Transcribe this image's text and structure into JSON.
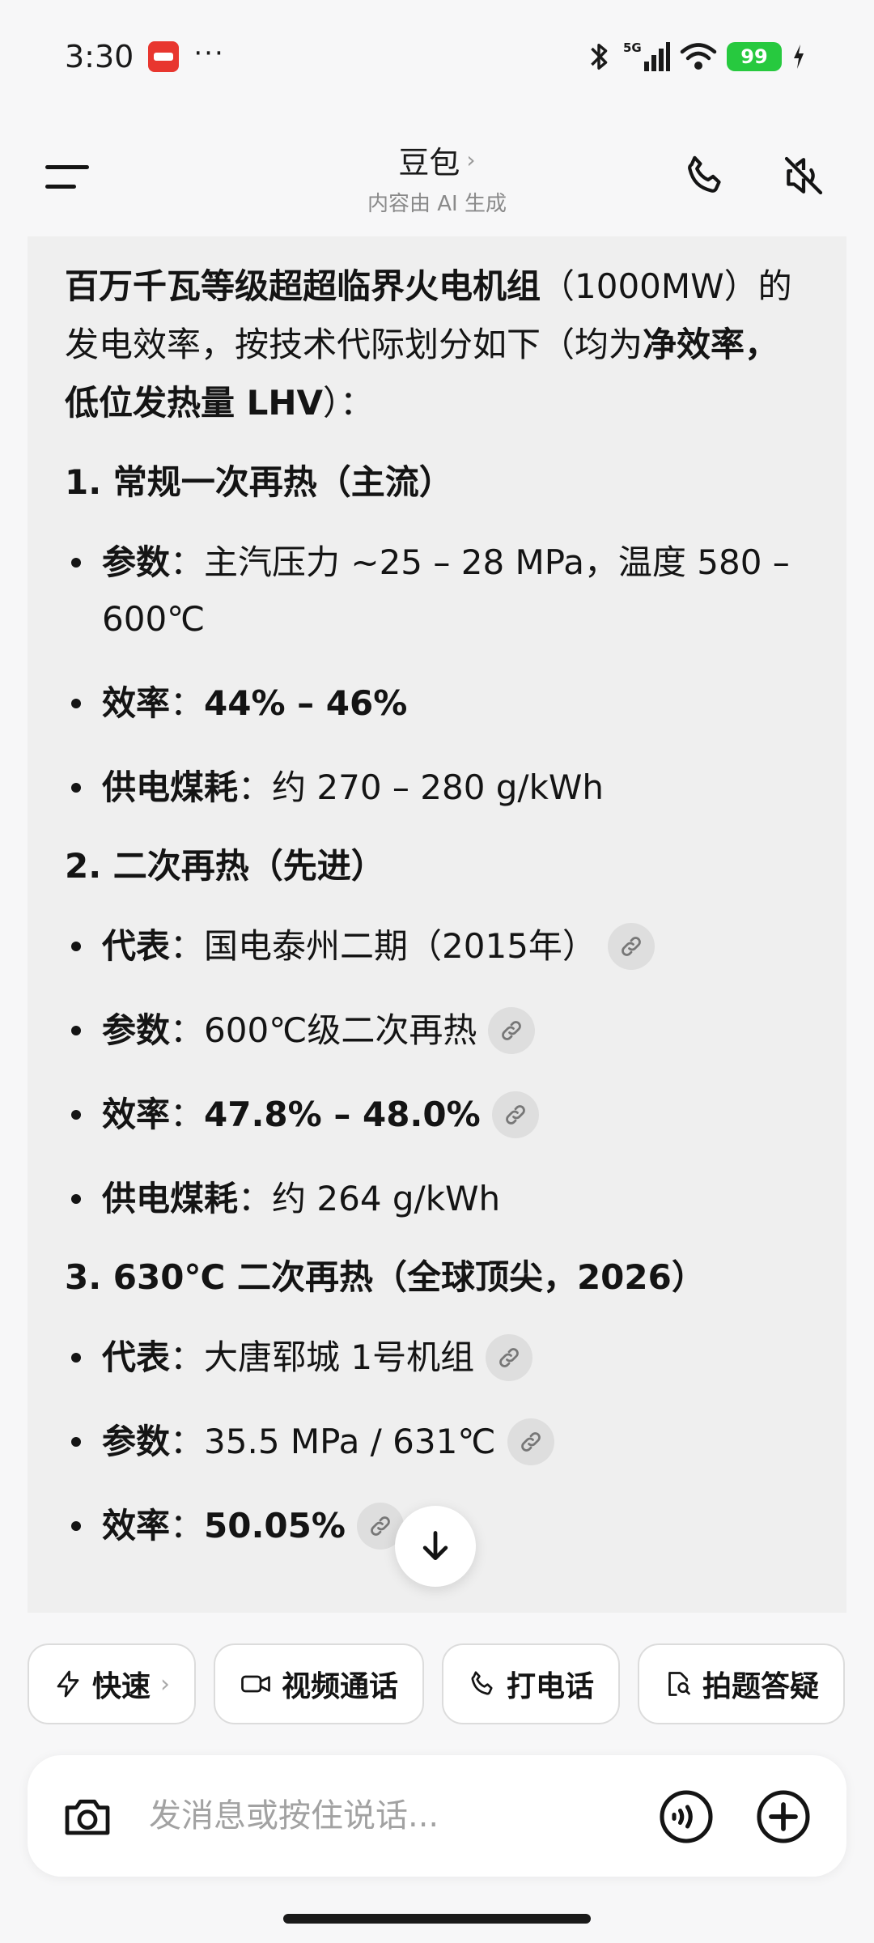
{
  "status": {
    "time": "3:30",
    "more": "···",
    "network": "5G",
    "battery": "99"
  },
  "header": {
    "title": "豆包",
    "title_chevron": "›",
    "subtitle": "内容由 AI 生成"
  },
  "answer": {
    "intro_bold": "百万千瓦等级超超临界火电机组",
    "intro_1": "（1000MW）的发电效率，按技术代际划分如下（均为",
    "intro_bold_2": "净效率，低位发热量 LHV",
    "intro_2": "）：",
    "sections": [
      {
        "title": "1. 常规一次再热（主流）",
        "items": [
          {
            "label": "参数",
            "sep": "：",
            "text": "主汽压力 ~25 – 28 MPa，温度 580 – 600℃"
          },
          {
            "label": "效率",
            "sep": "：",
            "text": "44% – 46%"
          },
          {
            "label": "供电煤耗",
            "sep": "：",
            "text": "约 270 – 280 g/kWh"
          }
        ]
      },
      {
        "title": "2. 二次再热（先进）",
        "items": [
          {
            "label": "代表",
            "sep": "：",
            "text": "国电泰州二期（2015年）"
          },
          {
            "label": "参数",
            "sep": "：",
            "text": "600℃级二次再热"
          },
          {
            "label": "效率",
            "sep": "：",
            "text": "47.8% – 48.0%"
          },
          {
            "label": "供电煤耗",
            "sep": "：",
            "text": "约 264 g/kWh"
          }
        ]
      },
      {
        "title": "3. 630℃ 二次再热（全球顶尖，2026）",
        "items": [
          {
            "label": "代表",
            "sep": "：",
            "text": "大唐郓城 1号机组"
          },
          {
            "label": "参数",
            "sep": "：",
            "text": "35.5 MPa / 631℃"
          },
          {
            "label": "效率",
            "sep": "：",
            "text": "50.05%"
          }
        ]
      }
    ]
  },
  "quick_actions": [
    {
      "label": "快速",
      "chevron": "›"
    },
    {
      "label": "视频通话"
    },
    {
      "label": "打电话"
    },
    {
      "label": "拍题答疑"
    }
  ],
  "input": {
    "placeholder": "发消息或按住说话..."
  },
  "colors": {
    "battery": "#27c93f",
    "card_bg": "#efefef",
    "chip_bg": "#dedede"
  }
}
